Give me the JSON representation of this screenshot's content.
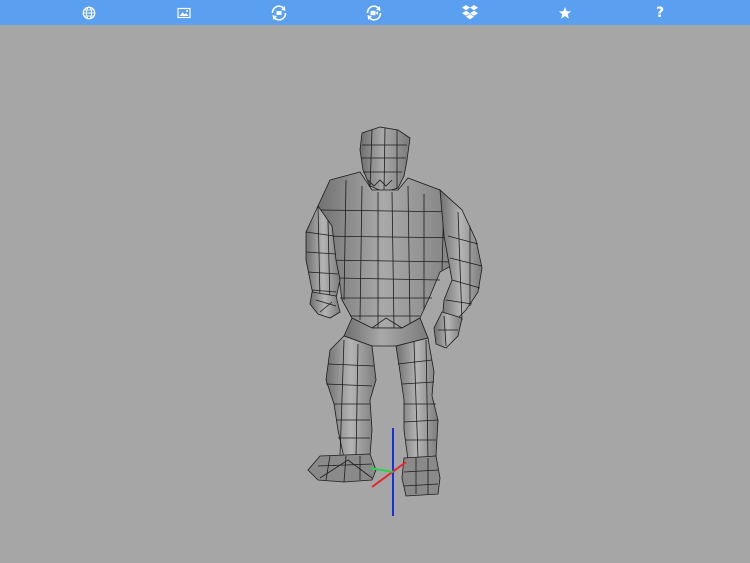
{
  "app": {
    "background_color": "#a6a6a6",
    "toolbar_color": "#5a9ff0"
  },
  "toolbar": {
    "items": [
      {
        "icon": "globe-icon"
      },
      {
        "icon": "image-icon"
      },
      {
        "icon": "rotate-view-icon"
      },
      {
        "icon": "camera-record-icon"
      },
      {
        "icon": "dropbox-icon"
      },
      {
        "icon": "star-icon"
      },
      {
        "icon": "help-icon",
        "label": "?"
      }
    ]
  },
  "viewport": {
    "model": "wireframe-humanoid-figure",
    "mesh_color": "#8c8c8c",
    "axis_colors": {
      "x": "#e8262b",
      "y": "#2bd24a",
      "z": "#1a2fe0"
    }
  }
}
